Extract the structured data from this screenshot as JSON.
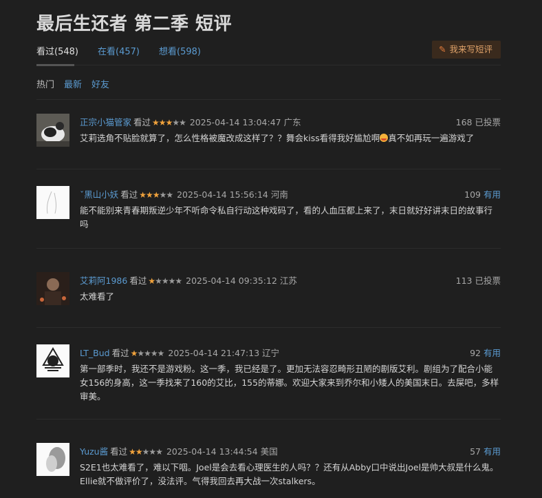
{
  "page_title": "最后生还者 第二季 短评",
  "tabs": [
    {
      "label": "看过(548)"
    },
    {
      "label": "在看(457)"
    },
    {
      "label": "想看(598)"
    }
  ],
  "write_button": "我来写短评",
  "sort_options": [
    "热门",
    "最新",
    "好友"
  ],
  "reviews": [
    {
      "user": "正宗小猫管家",
      "status": "看过",
      "rating": 3,
      "time": "2025-04-14 13:04:47",
      "location": "广东",
      "votes": "168",
      "vote_label": "已投票",
      "text": "艾莉选角不贴脸就算了，怎么性格被魔改成这样了？？舞会kiss看得我好尴尬啊",
      "text_tail": "真不如再玩一遍游戏了"
    },
    {
      "user": "ˇ黑山小妖",
      "status": "看过",
      "rating": 3,
      "time": "2025-04-14 15:56:14",
      "location": "河南",
      "votes": "109",
      "vote_label": "有用",
      "text": "能不能别来青春期叛逆少年不听命令私自行动这种戏码了，看的人血压都上来了，末日就好好讲末日的故事行吗",
      "text_tail": ""
    },
    {
      "user": "艾莉阿1986",
      "status": "看过",
      "rating": 1,
      "time": "2025-04-14 09:35:12",
      "location": "江苏",
      "votes": "113",
      "vote_label": "已投票",
      "text": "太难看了",
      "text_tail": ""
    },
    {
      "user": "LT_Bud",
      "status": "看过",
      "rating": 1,
      "time": "2025-04-14 21:47:13",
      "location": "辽宁",
      "votes": "92",
      "vote_label": "有用",
      "text": "第一部季时，我还不是游戏粉。这一季，我已经是了。更加无法容忍畸形丑陋的剧版艾利。剧组为了配合小能女156的身高，这一季找来了160的艾比，155的蒂娜。欢迎大家来到乔尔和小矮人的美国末日。去屎吧，多样审美。",
      "text_tail": ""
    },
    {
      "user": "Yuzu酱",
      "status": "看过",
      "rating": 2,
      "time": "2025-04-14 13:44:54",
      "location": "美国",
      "votes": "57",
      "vote_label": "有用",
      "text": "S2E1也太难看了，难以下咽。Joel是会去看心理医生的人吗？？还有从Abby口中说出Joel是帅大叔是什么鬼。Ellie就不做评价了，没法评。气得我回去再大战一次stalkers。",
      "text_tail": ""
    }
  ]
}
